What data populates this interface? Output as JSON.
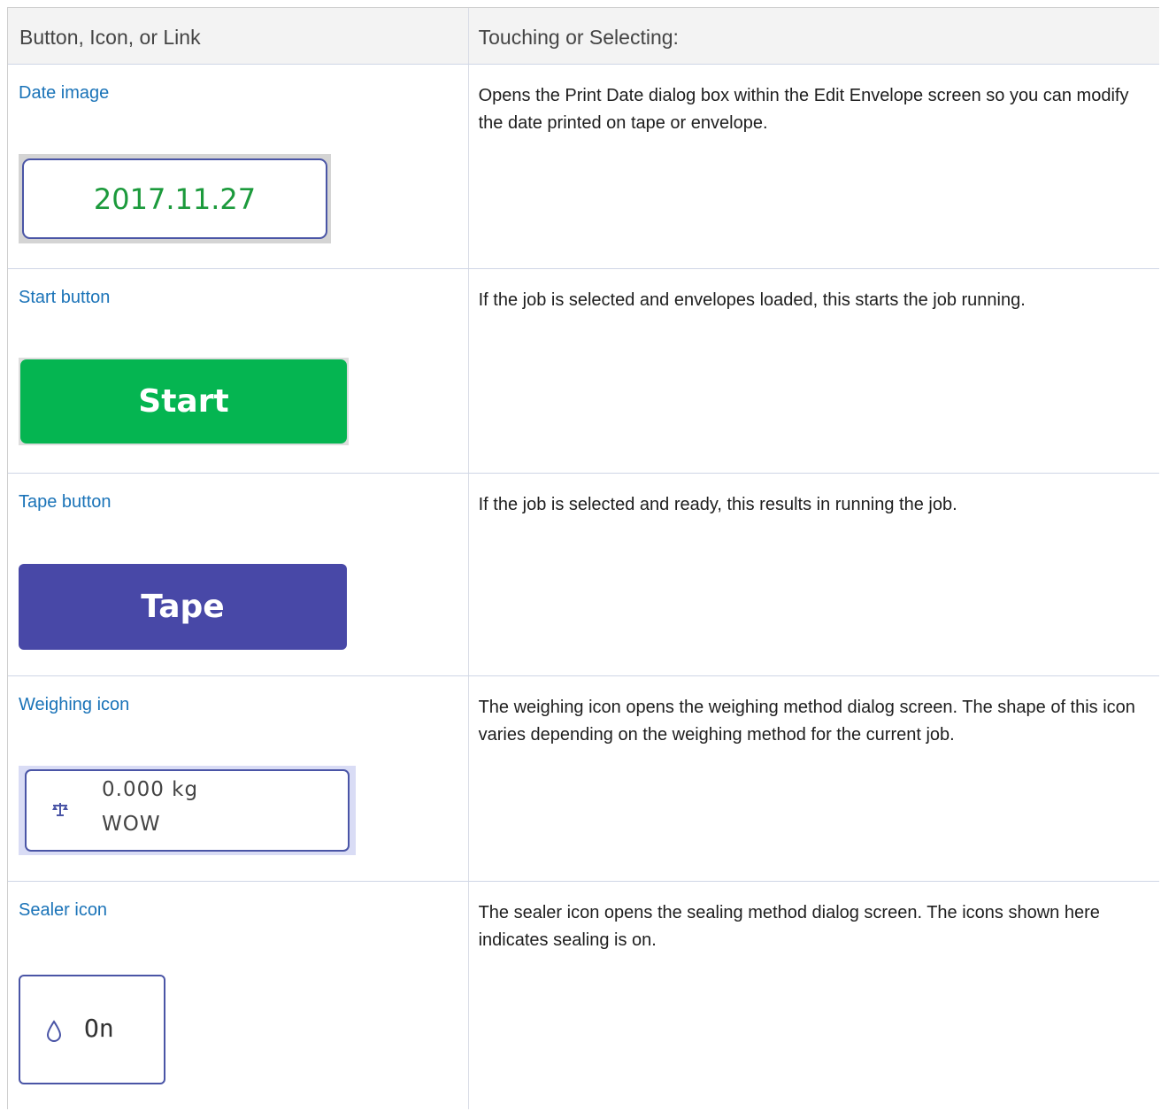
{
  "table": {
    "header": {
      "col1": "Button, Icon, or Link",
      "col2": "Touching or Selecting:"
    },
    "rows": [
      {
        "link": "Date image",
        "description": "Opens the Print Date dialog box within the Edit Envelope screen so you can modify the date printed on tape or envelope.",
        "image_text": "2017.11.27"
      },
      {
        "link": "Start button",
        "description": "If the job is selected and envelopes loaded, this starts the job running.",
        "image_text": "Start"
      },
      {
        "link": "Tape button",
        "description": "If the job is selected and ready, this results in running the job.",
        "image_text": "Tape"
      },
      {
        "link": "Weighing icon",
        "description": "The weighing icon opens the weighing method dialog screen. The shape of this icon varies depending on the weighing method for the current job.",
        "image_line1": "0.000 kg",
        "image_line2": "WOW",
        "image_icon": "scale-icon"
      },
      {
        "link": "Sealer icon",
        "description": "The sealer icon opens the sealing method dialog screen. The icons shown here indicates sealing is on.",
        "image_text": "On",
        "image_icon": "water-drop-icon"
      }
    ]
  },
  "colors": {
    "link": "#1a73b8",
    "start_green": "#05b551",
    "tape_purple": "#4848a7",
    "date_green": "#1c9a3c",
    "frame_border": "#4a55a6"
  }
}
